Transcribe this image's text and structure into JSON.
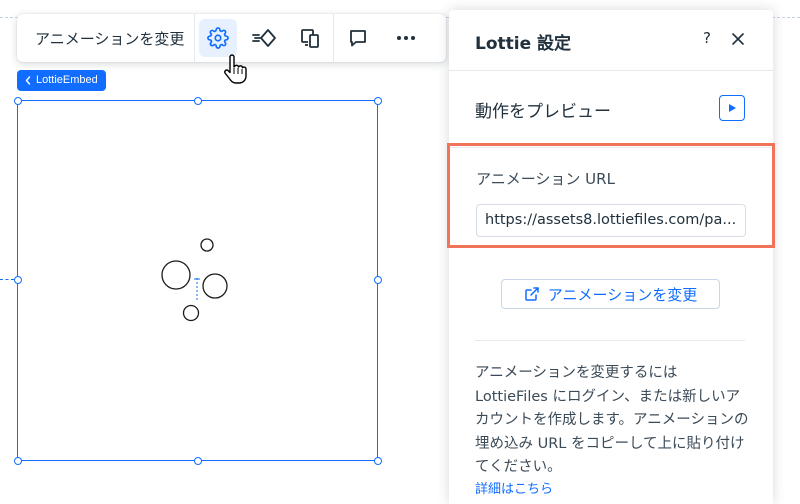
{
  "toolbar": {
    "change_animation_label": "アニメーションを変更",
    "icons": [
      "gear-icon",
      "animation-icon",
      "layout-icon",
      "comment-icon",
      "more-icon"
    ]
  },
  "breadcrumb": {
    "label": "LottieEmbed"
  },
  "panel": {
    "title": "Lottie 設定",
    "help": "?",
    "preview_label": "動作をプレビュー",
    "url_label": "アニメーション URL",
    "url_value": "https://assets8.lottiefiles.com/pa...",
    "change_button_label": "アニメーションを変更",
    "info_text": "アニメーションを変更するには LottieFiles にログイン、または新しいアカウントを作成します。アニメーションの埋め込み URL をコピーして上に貼り付けてください。",
    "info_link": "詳細はこちら"
  },
  "colors": {
    "accent": "#116dff",
    "highlight_border": "#f0735a",
    "active_button_bg": "#e7f0ff"
  }
}
